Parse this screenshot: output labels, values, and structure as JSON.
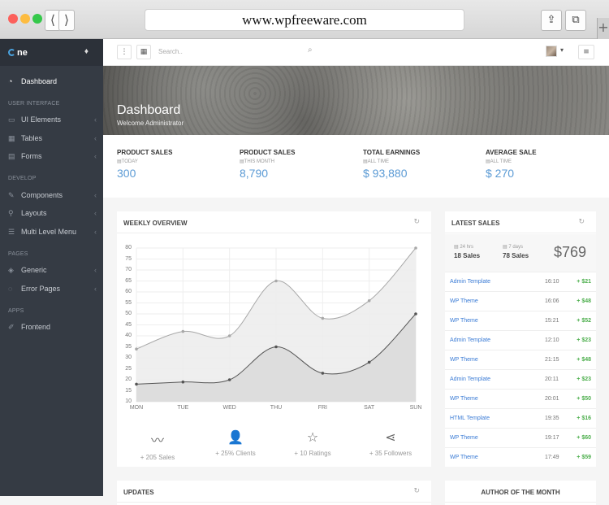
{
  "browser": {
    "url": "www.wpfreeware.com",
    "back": "⟨",
    "forward": "⟩",
    "share": "⇪",
    "tabs": "⧉",
    "newtab": "+"
  },
  "sidebar": {
    "brand": "ne",
    "dashboard": "Dashboard",
    "sections": [
      {
        "title": "USER INTERFACE",
        "items": [
          "UI Elements",
          "Tables",
          "Forms"
        ]
      },
      {
        "title": "DEVELOP",
        "items": [
          "Components",
          "Layouts",
          "Multi Level Menu"
        ]
      },
      {
        "title": "PAGES",
        "items": [
          "Generic",
          "Error Pages"
        ]
      },
      {
        "title": "APPS",
        "items": [
          "Frontend"
        ]
      }
    ]
  },
  "topbar": {
    "search_placeholder": "Search.."
  },
  "hero": {
    "title": "Dashboard",
    "subtitle": "Welcome Administrator"
  },
  "stats": [
    {
      "title": "PRODUCT SALES",
      "period": "TODAY",
      "value": "300"
    },
    {
      "title": "PRODUCT SALES",
      "period": "THIS MONTH",
      "value": "8,790"
    },
    {
      "title": "TOTAL EARNINGS",
      "period": "ALL TIME",
      "value": "$ 93,880"
    },
    {
      "title": "AVERAGE SALE",
      "period": "ALL TIME",
      "value": "$ 270"
    }
  ],
  "weekly": {
    "title": "WEEKLY OVERVIEW"
  },
  "chart_data": {
    "type": "area",
    "categories": [
      "MON",
      "TUE",
      "WED",
      "THU",
      "FRI",
      "SAT",
      "SUN"
    ],
    "ylim": [
      10,
      80
    ],
    "yticks": [
      10,
      15,
      20,
      25,
      30,
      35,
      40,
      45,
      50,
      55,
      60,
      65,
      70,
      75,
      80
    ],
    "series": [
      {
        "values": [
          34,
          42,
          40,
          65,
          48,
          56,
          80
        ],
        "color": "#a8a8a8"
      },
      {
        "values": [
          18,
          19,
          20,
          35,
          23,
          28,
          50
        ],
        "color": "#555555"
      }
    ],
    "grid": true
  },
  "weekly_footer": [
    {
      "icon": "trend-icon",
      "glyph": "〰",
      "label": "+ 205 Sales"
    },
    {
      "icon": "users-icon",
      "glyph": "👤",
      "label": "+ 25% Clients"
    },
    {
      "icon": "star-icon",
      "glyph": "☆",
      "label": "+ 10 Ratings"
    },
    {
      "icon": "share-icon",
      "glyph": "⋖",
      "label": "+ 35 Followers"
    }
  ],
  "latest": {
    "title": "LATEST SALES",
    "summary": [
      {
        "period": "24 hrs",
        "value": "18 Sales"
      },
      {
        "period": "7 days",
        "value": "78 Sales"
      }
    ],
    "total": "$769",
    "rows": [
      {
        "name": "Admin Template",
        "time": "16:10",
        "amount": "+ $21"
      },
      {
        "name": "WP Theme",
        "time": "16:06",
        "amount": "+ $48"
      },
      {
        "name": "WP Theme",
        "time": "15:21",
        "amount": "+ $52"
      },
      {
        "name": "Admin Template",
        "time": "12:10",
        "amount": "+ $23"
      },
      {
        "name": "WP Theme",
        "time": "21:15",
        "amount": "+ $48"
      },
      {
        "name": "Admin Template",
        "time": "20:11",
        "amount": "+ $23"
      },
      {
        "name": "WP Theme",
        "time": "20:01",
        "amount": "+ $50"
      },
      {
        "name": "HTML Template",
        "time": "19:35",
        "amount": "+ $16"
      },
      {
        "name": "WP Theme",
        "time": "19:17",
        "amount": "+ $60"
      },
      {
        "name": "WP Theme",
        "time": "17:49",
        "amount": "+ $59"
      }
    ]
  },
  "updates": {
    "title": "UPDATES"
  },
  "author": {
    "title": "AUTHOR OF THE MONTH"
  }
}
